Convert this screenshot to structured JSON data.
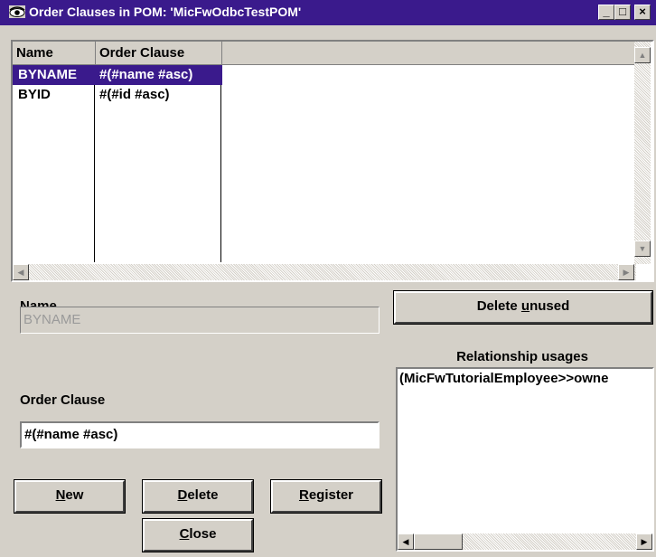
{
  "window": {
    "title": "Order Clauses in POM: 'MicFwOdbcTestPOM'",
    "minimize_glyph": "_",
    "maximize_glyph": "□",
    "close_glyph": "×"
  },
  "grid": {
    "columns": [
      "Name",
      "Order Clause"
    ],
    "rows": [
      {
        "name": "BYNAME",
        "clause": "#(#name #asc)",
        "selected": true
      },
      {
        "name": "BYID",
        "clause": "#(#id #asc)",
        "selected": false
      }
    ]
  },
  "form": {
    "name_label": "Name",
    "name_value": "BYNAME",
    "order_clause_label": "Order Clause",
    "order_clause_value": "#(#name #asc)"
  },
  "buttons": {
    "new": {
      "pre": "",
      "accel": "N",
      "post": "ew"
    },
    "delete": {
      "pre": "",
      "accel": "D",
      "post": "elete"
    },
    "register": {
      "pre": "",
      "accel": "R",
      "post": "egister"
    },
    "close": {
      "pre": "",
      "accel": "C",
      "post": "lose"
    },
    "delete_unused": {
      "pre": "Delete ",
      "accel": "u",
      "post": "nused"
    }
  },
  "relationships": {
    "label": "Relationship usages",
    "items": [
      "(MicFwTutorialEmployee>>owne"
    ]
  },
  "icons": {
    "app": "eye-icon",
    "scroll_up": "arrow-up-icon",
    "scroll_down": "arrow-down-icon",
    "scroll_left": "arrow-left-icon",
    "scroll_right": "arrow-right-icon"
  },
  "colors": {
    "titlebar": "#3a1a8c",
    "selection": "#3a1a8c",
    "face": "#d4d0c8"
  }
}
